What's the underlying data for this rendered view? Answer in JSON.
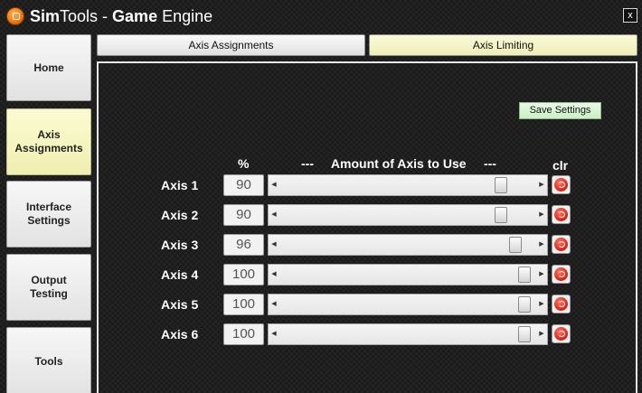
{
  "window": {
    "title_bold": "Sim",
    "title_rest": "Tools - ",
    "title_bold2": "Game",
    "title_rest2": " Engine",
    "close_label": "x"
  },
  "sidebar": {
    "items": [
      {
        "label": "Home",
        "active": false
      },
      {
        "label": "Axis Assignments",
        "active": true
      },
      {
        "label": "Interface Settings",
        "active": false
      },
      {
        "label": "Output Testing",
        "active": false
      },
      {
        "label": "Tools",
        "active": false
      }
    ]
  },
  "tabs": [
    {
      "label": "Axis Assignments",
      "active": false
    },
    {
      "label": "Axis Limiting",
      "active": true
    }
  ],
  "main": {
    "save_label": "Save Settings",
    "pct_header": "%",
    "amount_header": "---     Amount of Axis to Use     ---",
    "clr_header": "clr",
    "axes": [
      {
        "label": "Axis 1",
        "value": "90"
      },
      {
        "label": "Axis 2",
        "value": "90"
      },
      {
        "label": "Axis 3",
        "value": "96"
      },
      {
        "label": "Axis 4",
        "value": "100"
      },
      {
        "label": "Axis 5",
        "value": "100"
      },
      {
        "label": "Axis 6",
        "value": "100"
      }
    ]
  },
  "icons": {
    "app": "simtools-logo-icon",
    "close": "close-icon",
    "clear": "clear-icon",
    "scroll_left": "scroll-left-icon",
    "scroll_right": "scroll-right-icon"
  },
  "colors": {
    "active_tab": "#f5f5c8",
    "save_button": "#d6f5d0",
    "clear_button": "#e1281a"
  }
}
